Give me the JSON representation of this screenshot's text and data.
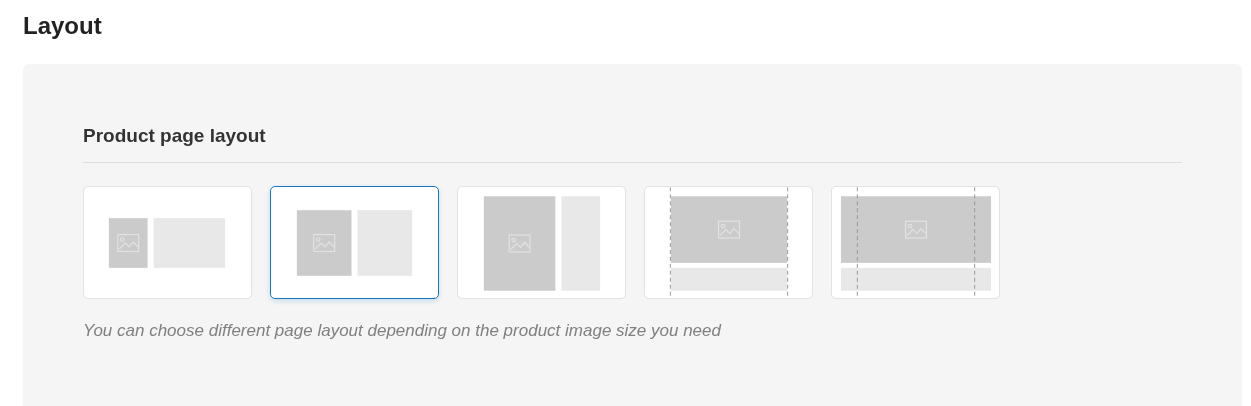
{
  "title": "Layout",
  "section": {
    "heading": "Product page layout",
    "layouts": [
      {
        "kind": "small-image",
        "selected": false
      },
      {
        "kind": "medium-image",
        "selected": true
      },
      {
        "kind": "large-image",
        "selected": false
      },
      {
        "kind": "full-width",
        "selected": false
      },
      {
        "kind": "full-bleed",
        "selected": false
      }
    ],
    "help": "You can choose different page layout depending on the product image size you need"
  }
}
